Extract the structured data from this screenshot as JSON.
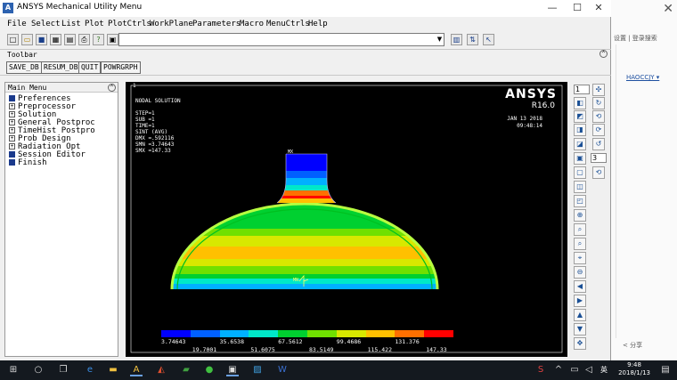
{
  "window": {
    "title": "ANSYS Mechanical Utility Menu",
    "minimize": "—",
    "maximize": "☐",
    "close": "✕"
  },
  "menu": [
    "File",
    "Select",
    "List",
    "Plot",
    "PlotCtrls",
    "WorkPlane",
    "Parameters",
    "Macro",
    "MenuCtrls",
    "Help"
  ],
  "toolbar": {
    "label": "Toolbar",
    "buttons": [
      "SAVE_DB",
      "RESUM_DB",
      "QUIT",
      "POWRGRPH"
    ]
  },
  "main_menu": {
    "title": "Main Menu",
    "items": [
      {
        "label": "Preferences",
        "kind": "square"
      },
      {
        "label": "Preprocessor",
        "kind": "expand"
      },
      {
        "label": "Solution",
        "kind": "expand"
      },
      {
        "label": "General Postproc",
        "kind": "expand"
      },
      {
        "label": "TimeHist Postpro",
        "kind": "expand"
      },
      {
        "label": "Prob Design",
        "kind": "expand"
      },
      {
        "label": "Radiation Opt",
        "kind": "expand"
      },
      {
        "label": "Session Editor",
        "kind": "square"
      },
      {
        "label": "Finish",
        "kind": "square"
      }
    ]
  },
  "graphics": {
    "window_number": "1",
    "info": [
      "NODAL SOLUTION",
      "",
      "STEP=1",
      "SUB =1",
      "TIME=1",
      "SINT     (AVG)",
      "DMX =.592116",
      "SMN =3.74643",
      "SMX =147.33"
    ],
    "logo": "ANSYS",
    "version": "R16.0",
    "date": "JAN 13 2018",
    "time": "09:48:14",
    "mx_label": "MX",
    "mn_label": "MN",
    "legend_top": [
      "3.74643",
      "35.6538",
      "67.5612",
      "99.4686",
      "131.376"
    ],
    "legend_bottom": [
      "19.7001",
      "51.6075",
      "83.5149",
      "115.422",
      "147.33"
    ],
    "legend_colors": [
      "#0000ff",
      "#0060ff",
      "#00b0ff",
      "#00e8c8",
      "#00d030",
      "#70e000",
      "#d8e800",
      "#ffc000",
      "#ff7000",
      "#ff0000"
    ]
  },
  "right_tools": {
    "select1": "1",
    "select2": "3"
  },
  "browser": {
    "row1": "设置 | 登录搜索",
    "row2": "HAOCCJY ▾",
    "share": "< 分享"
  },
  "taskbar": {
    "ime": "英",
    "time": "9:48",
    "date": "2018/1/13"
  }
}
